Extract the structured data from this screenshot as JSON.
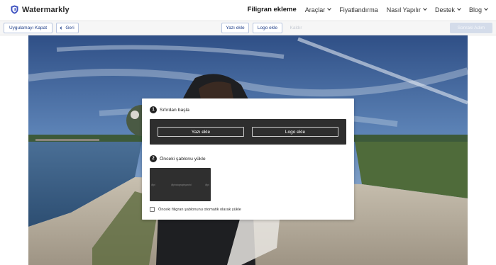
{
  "app": {
    "name": "Watermarkly",
    "accent": "#3b4fbf"
  },
  "nav": {
    "items": [
      {
        "label": "Filigran ekleme",
        "active": true,
        "dropdown": false
      },
      {
        "label": "Araçlar",
        "active": false,
        "dropdown": true
      },
      {
        "label": "Fiyatlandırma",
        "active": false,
        "dropdown": false
      },
      {
        "label": "Nasıl Yapılır",
        "active": false,
        "dropdown": true
      },
      {
        "label": "Destek",
        "active": false,
        "dropdown": true
      },
      {
        "label": "Blog",
        "active": false,
        "dropdown": true
      }
    ]
  },
  "toolbar": {
    "close_app": "Uygulamayı Kapat",
    "back": "Geri",
    "add_text": "Yazı ekle",
    "add_logo": "Logo ekle",
    "delete": "Kaldır",
    "next": "Sonraki Adım"
  },
  "modal": {
    "step1": {
      "num": "1",
      "label": "Sıfırdan başla"
    },
    "add_text": "Yazı ekle",
    "add_logo": "Logo ekle",
    "step2": {
      "num": "2",
      "label": "Önceki şablonu yükle"
    },
    "template_watermark": "@photographyworld",
    "template_corner": "@pl",
    "auto_load_label": "Önceki filigran şablonunu otomatik olarak yükle",
    "auto_load_checked": false
  },
  "colors": {
    "button_text": "#1f3f8a",
    "button_border": "#b9c6e0",
    "panel_bg": "#2e2e2e"
  }
}
